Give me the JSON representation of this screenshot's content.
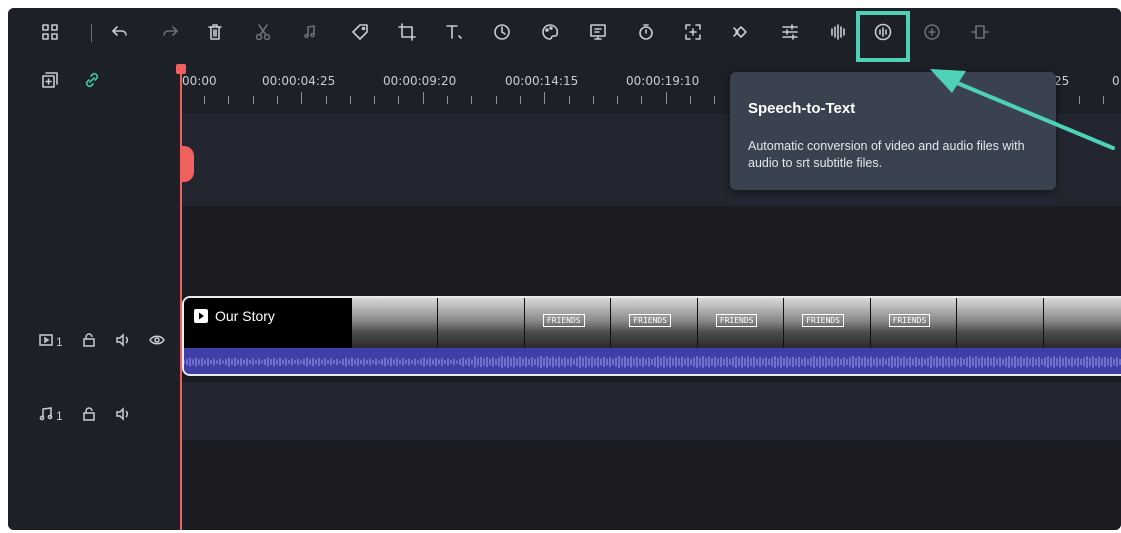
{
  "toolbar": {
    "tools": [
      {
        "name": "layout-icon"
      },
      {
        "name": "undo-icon"
      },
      {
        "name": "redo-icon"
      },
      {
        "name": "delete-icon"
      },
      {
        "name": "cut-icon"
      },
      {
        "name": "audio-icon"
      },
      {
        "name": "tag-icon"
      },
      {
        "name": "crop-icon"
      },
      {
        "name": "text-icon"
      },
      {
        "name": "speed-icon"
      },
      {
        "name": "color-icon"
      },
      {
        "name": "green-screen-icon"
      },
      {
        "name": "timer-icon"
      },
      {
        "name": "zoom-icon"
      },
      {
        "name": "keyframe-icon"
      },
      {
        "name": "adjust-icon"
      },
      {
        "name": "audio-mixer-icon"
      },
      {
        "name": "speech-to-text-icon"
      },
      {
        "name": "auto-reframe-icon"
      },
      {
        "name": "freeze-frame-icon"
      }
    ],
    "highlight_color": "#4fd1b8"
  },
  "ruler": {
    "labels": [
      "00:00",
      "00:00:04:25",
      "00:00:09:20",
      "00:00:14:15",
      "00:00:19:10",
      ":25",
      "0"
    ]
  },
  "tooltip": {
    "title": "Speech-to-Text",
    "description": "Automatic conversion of video and audio files with audio to srt subtitle files."
  },
  "tracks": {
    "video": {
      "number": "1"
    },
    "audio": {
      "number": "1"
    }
  },
  "clip": {
    "title": "Our Story",
    "thumb_text": "FRIENDS"
  },
  "colors": {
    "playhead": "#f0605e",
    "audio_wave": "#3f3fa8",
    "arrow": "#4fd1b8"
  }
}
